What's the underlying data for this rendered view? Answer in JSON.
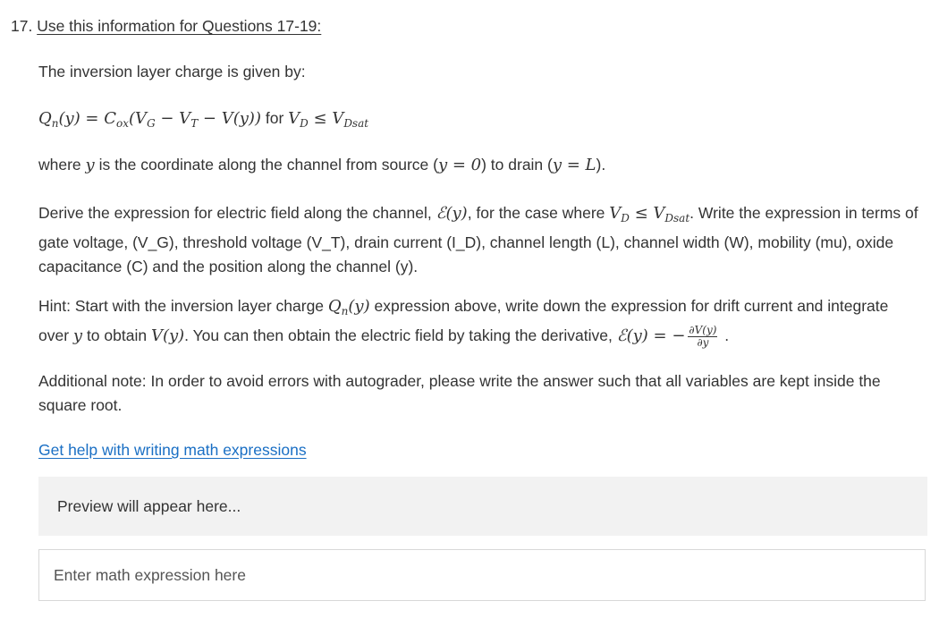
{
  "question": {
    "number": "17.",
    "info_link": "Use this information for Questions 17-19:"
  },
  "intro": "The inversion layer charge is given by:",
  "formula": {
    "lhs": "Q",
    "lhs_sub": "n",
    "lhs_arg": "(y) = ",
    "c": "C",
    "c_sub": "ox",
    "rhs": "(V",
    "vg_sub": "G",
    "minus_vt": " − V",
    "vt_sub": "T",
    "minus_vy": " − V(y))",
    "condition": "for",
    "vd": "V",
    "vd_sub": "D",
    "le": " ≤ V",
    "vdsat_sub": "Dsat"
  },
  "where_text": {
    "p1": "where ",
    "y": "y",
    "p2": " is the coordinate along the channel from source (",
    "y0": "y = 0",
    "p3": ") to drain (",
    "yL": "y = L",
    "p4": ")."
  },
  "derive": {
    "p1": "Derive the expression for electric field along the channel, ",
    "Ey": "ℰ(y)",
    "p2": ", for the case where ",
    "cond_v": "V",
    "cond_sub": "D",
    "cond_le": " ≤ V",
    "cond_sat": "Dsat",
    "p3": ". Write the expression in terms of gate voltage, (V_G), threshold voltage (V_T), drain current (I_D), channel length (L), channel width (W), mobility (mu), oxide capacitance (C) and the position along the channel (y)."
  },
  "hint": {
    "p1": "Hint: Start with the inversion layer charge ",
    "q": "Q",
    "q_sub": "n",
    "q_arg": "(y)",
    "p2": " expression above, write down the expression for drift current and integrate over ",
    "y": "y",
    "p3": " to obtain ",
    "vy": "V(y)",
    "p4": ". You can then obtain the electric field by taking the derivative, ",
    "Ey": "ℰ(y) = −",
    "frac_num": "∂V(y)",
    "frac_den": "∂y",
    "p5": " ."
  },
  "note": "Additional note: In order to avoid errors with autograder, please write the answer such that all variables are kept inside the square root.",
  "help_link": "Get help with writing math expressions",
  "preview": "Preview will appear here...",
  "input": {
    "placeholder": "Enter math expression here",
    "value": ""
  }
}
